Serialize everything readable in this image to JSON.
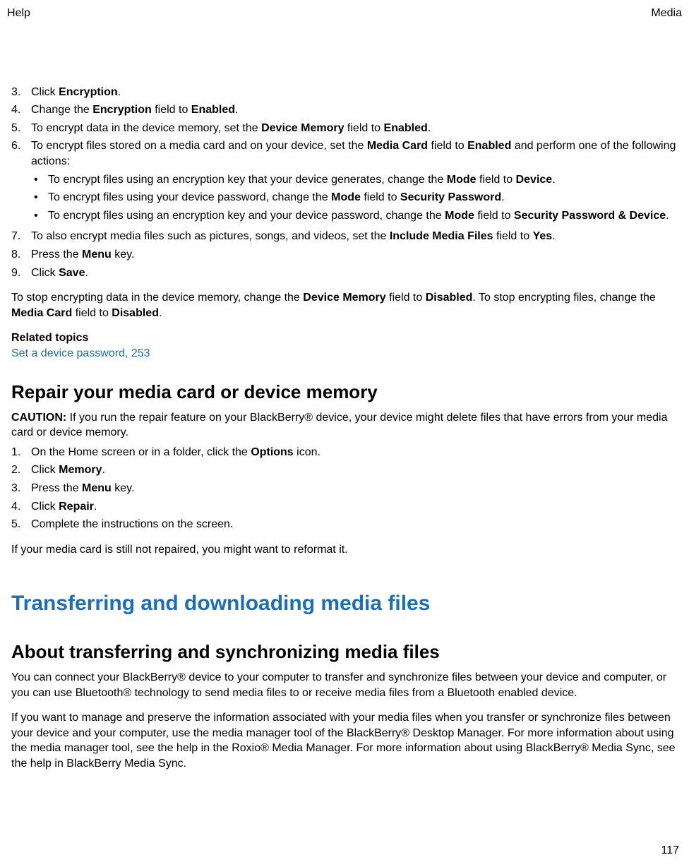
{
  "header": {
    "left": "Help",
    "right": "Media"
  },
  "encryption_steps": {
    "s3": {
      "num": "3.",
      "pre": "Click ",
      "b1": "Encryption",
      "post": "."
    },
    "s4": {
      "num": "4.",
      "pre": "Change the ",
      "b1": "Encryption",
      "mid1": " field to ",
      "b2": "Enabled",
      "post": "."
    },
    "s5": {
      "num": "5.",
      "pre": "To encrypt data in the device memory, set the ",
      "b1": "Device Memory",
      "mid1": " field to ",
      "b2": "Enabled",
      "post": "."
    },
    "s6": {
      "num": "6.",
      "pre": "To encrypt files stored on a media card and on your device, set the ",
      "b1": "Media Card",
      "mid1": " field to ",
      "b2": "Enabled",
      "post": " and perform one of the following actions:"
    },
    "s6a": {
      "pre": "To encrypt files using an encryption key that your device generates, change the ",
      "b1": "Mode",
      "mid1": " field to ",
      "b2": "Device",
      "post": "."
    },
    "s6b": {
      "pre": "To encrypt files using your device password, change the ",
      "b1": "Mode",
      "mid1": " field to ",
      "b2": "Security Password",
      "post": "."
    },
    "s6c": {
      "pre": "To encrypt files using an encryption key and your device password, change the ",
      "b1": "Mode",
      "mid1": " field to ",
      "b2": "Security Password & Device",
      "post": "."
    },
    "s7": {
      "num": "7.",
      "pre": "To also encrypt media files such as pictures, songs, and videos, set the ",
      "b1": "Include Media Files",
      "mid1": " field to ",
      "b2": "Yes",
      "post": "."
    },
    "s8": {
      "num": "8.",
      "pre": "Press the ",
      "b1": "Menu",
      "post": " key."
    },
    "s9": {
      "num": "9.",
      "pre": "Click ",
      "b1": "Save",
      "post": "."
    }
  },
  "stop_para": {
    "pre": "To stop encrypting data in the device memory, change the ",
    "b1": "Device Memory",
    "mid1": " field to ",
    "b2": "Disabled",
    "mid2": ". To stop encrypting files, change the ",
    "b3": "Media Card",
    "mid3": " field to ",
    "b4": "Disabled",
    "post": "."
  },
  "related": {
    "heading": "Related topics",
    "link": "Set a device password, 253"
  },
  "repair": {
    "heading": "Repair your media card or device memory",
    "caution_label": "CAUTION: ",
    "caution_text": " If you run the repair feature on your BlackBerry® device, your device might delete files that have errors from your media card or device memory.",
    "s1": {
      "num": "1.",
      "pre": "On the Home screen or in a folder, click the ",
      "b1": "Options",
      "post": " icon."
    },
    "s2": {
      "num": "2.",
      "pre": "Click ",
      "b1": "Memory",
      "post": "."
    },
    "s3": {
      "num": "3.",
      "pre": "Press the ",
      "b1": "Menu",
      "post": " key."
    },
    "s4": {
      "num": "4.",
      "pre": "Click ",
      "b1": "Repair",
      "post": "."
    },
    "s5": {
      "num": "5.",
      "text": "Complete the instructions on the screen."
    },
    "after": "If your media card is still not repaired, you might want to reformat it."
  },
  "transfer": {
    "chapter": "Transferring and downloading media files",
    "section": "About transferring and synchronizing media files",
    "p1": "You can connect your BlackBerry® device to your computer to transfer and synchronize files between your device and computer, or you can use Bluetooth® technology to send media files to or receive media files from a Bluetooth enabled device.",
    "p2": "If you want to manage and preserve the information associated with your media files when you transfer or synchronize files between your device and your computer, use the media manager tool of the BlackBerry® Desktop Manager. For more information about using the media manager tool, see the help in the Roxio® Media Manager. For more information about using BlackBerry® Media Sync, see the help in BlackBerry Media Sync."
  },
  "page_number": "117"
}
